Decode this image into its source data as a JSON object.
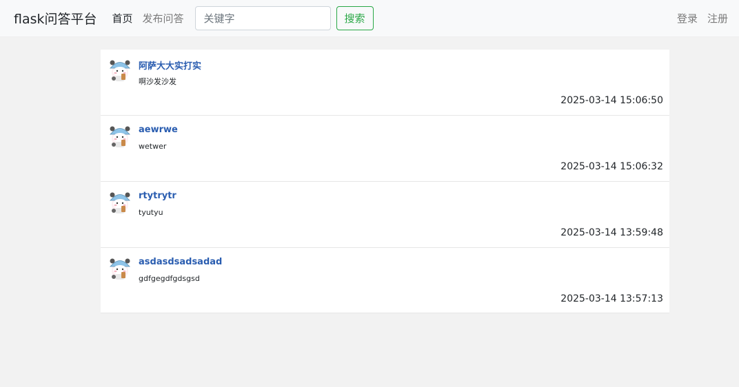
{
  "navbar": {
    "brand": "flask问答平台",
    "nav_home": "首页",
    "nav_publish": "发布问答",
    "search_placeholder": "关键字",
    "search_button": "搜索",
    "login": "登录",
    "register": "注册"
  },
  "questions": [
    {
      "title": "阿萨大大实打实",
      "content": "啊沙发沙发",
      "time": "2025-03-14 15:06:50"
    },
    {
      "title": "aewrwe",
      "content": "wetwer",
      "time": "2025-03-14 15:06:32"
    },
    {
      "title": "rtytrytr",
      "content": "tyutyu",
      "time": "2025-03-14 13:59:48"
    },
    {
      "title": "asdasdsadsadad",
      "content": "gdfgegdfgdsgsd",
      "time": "2025-03-14 13:57:13"
    }
  ],
  "colors": {
    "title_link": "#2a5db0",
    "search_green": "#28a745",
    "navbar_bg": "#f8f9fa",
    "page_bg": "#f2f2f2"
  },
  "icons": {
    "avatar": "avatar-cartoon-icon"
  }
}
